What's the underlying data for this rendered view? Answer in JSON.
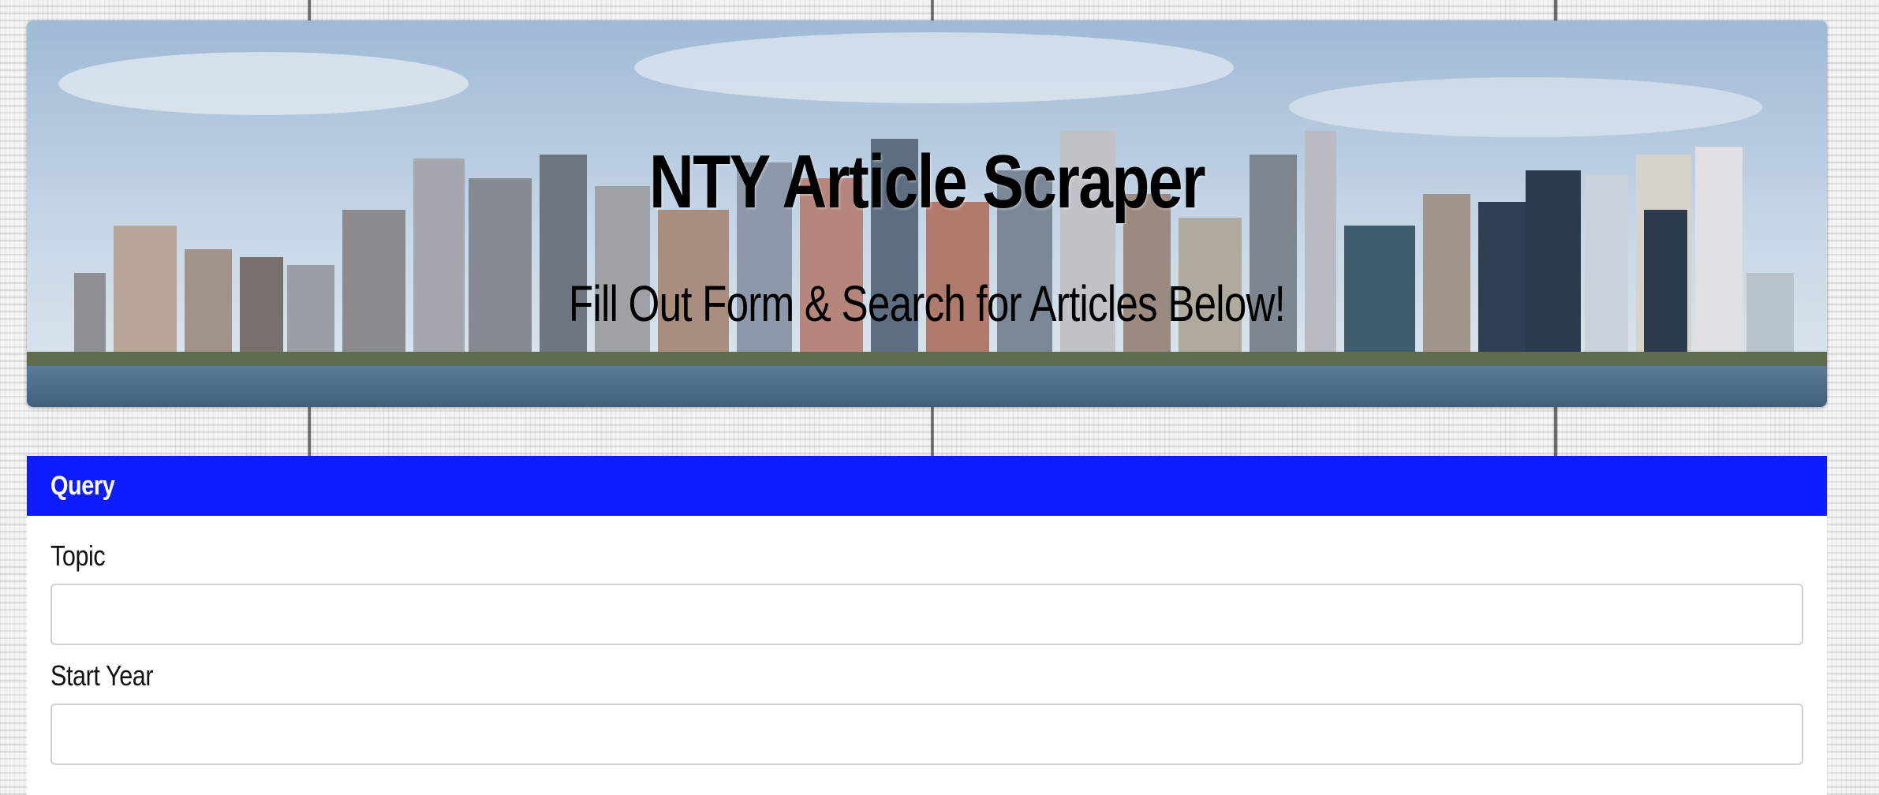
{
  "hero": {
    "title": "NTY Article Scraper",
    "subtitle": "Fill Out Form & Search for Articles Below!"
  },
  "panel": {
    "heading": "Query",
    "fields": [
      {
        "label": "Topic",
        "value": "",
        "placeholder": ""
      },
      {
        "label": "Start Year",
        "value": "",
        "placeholder": ""
      }
    ]
  },
  "colors": {
    "panel_heading": "#0c1cff",
    "sky": "#b9cfe3",
    "water": "#56799a"
  }
}
